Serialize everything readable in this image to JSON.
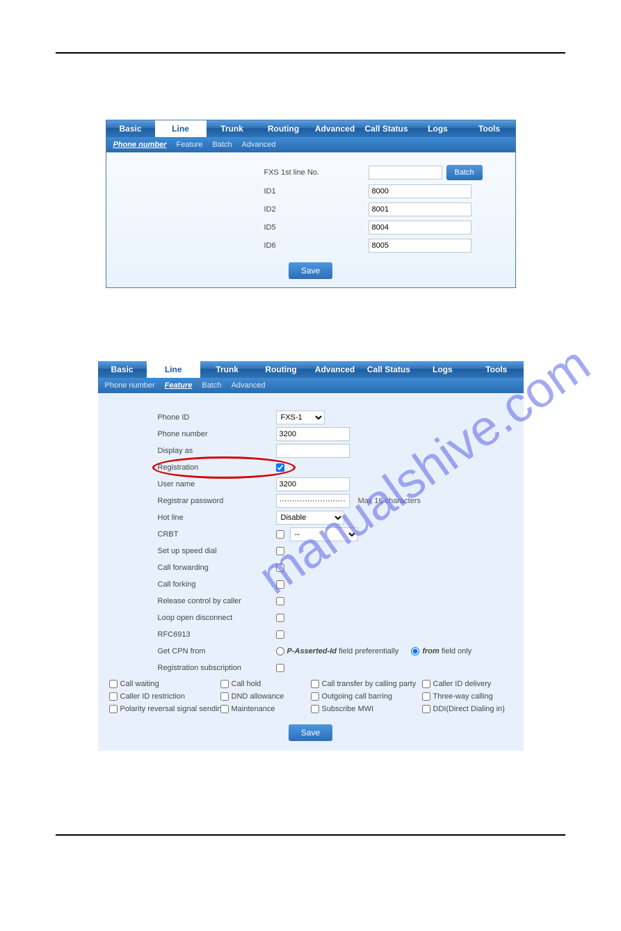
{
  "watermark_text": "manualshive.com",
  "topnav": {
    "tabs": [
      "Basic",
      "Line",
      "Trunk",
      "Routing",
      "Advanced",
      "Call Status",
      "Logs",
      "Tools"
    ]
  },
  "subnavA": {
    "items": [
      "Phone number",
      "Feature",
      "Batch",
      "Advanced"
    ],
    "activeIndex": 0
  },
  "subnavB": {
    "items": [
      "Phone number",
      "Feature",
      "Batch",
      "Advanced"
    ],
    "activeIndex": 1
  },
  "panel1": {
    "fxsLabel": "FXS 1st line No.",
    "batchButton": "Batch",
    "rows": [
      {
        "label": "ID1",
        "value": "8000"
      },
      {
        "label": "ID2",
        "value": "8001"
      },
      {
        "label": "ID5",
        "value": "8004"
      },
      {
        "label": "ID6",
        "value": "8005"
      }
    ],
    "save": "Save"
  },
  "panel2": {
    "phoneIdLabel": "Phone ID",
    "phoneIdValue": "FXS-1",
    "phoneNumberLabel": "Phone number",
    "phoneNumberValue": "3200",
    "displayAsLabel": "Display as",
    "displayAsValue": "",
    "registrationLabel": "Registration",
    "registrationChecked": true,
    "userNameLabel": "User name",
    "userNameValue": "3200",
    "regPassLabel": "Registrar password",
    "regPassValue": "································",
    "max16": "Max 16 characters",
    "hotLineLabel": "Hot line",
    "hotLineValue": "Disable",
    "crbtLabel": "CRBT",
    "crbtSelect": "--",
    "speedDialLabel": "Set up speed dial",
    "callForwardLabel": "Call forwarding",
    "callForkingLabel": "Call forking",
    "releaseCtrlLabel": "Release control by caller",
    "loopOpenLabel": "Loop open disconnect",
    "rfcLabel": "RFC6913",
    "getCpnLabel": "Get CPN from",
    "cpnOption1Pre": "P-Asserted-Id",
    "cpnOption1Post": " field preferentially",
    "cpnOption2Pre": "from",
    "cpnOption2Post": " field only",
    "regSubLabel": "Registration subscription",
    "grid": {
      "r1": [
        "Call waiting",
        "Call hold",
        "Call transfer by calling party",
        "Caller ID delivery"
      ],
      "r2": [
        "Caller ID restriction",
        "DND allowance",
        "Outgoing call barring",
        "Three-way calling"
      ],
      "r3": [
        "Polarity reversal signal sending",
        "Maintenance",
        "Subscribe MWI",
        "DDI(Direct Dialing in)"
      ]
    },
    "save": "Save"
  }
}
